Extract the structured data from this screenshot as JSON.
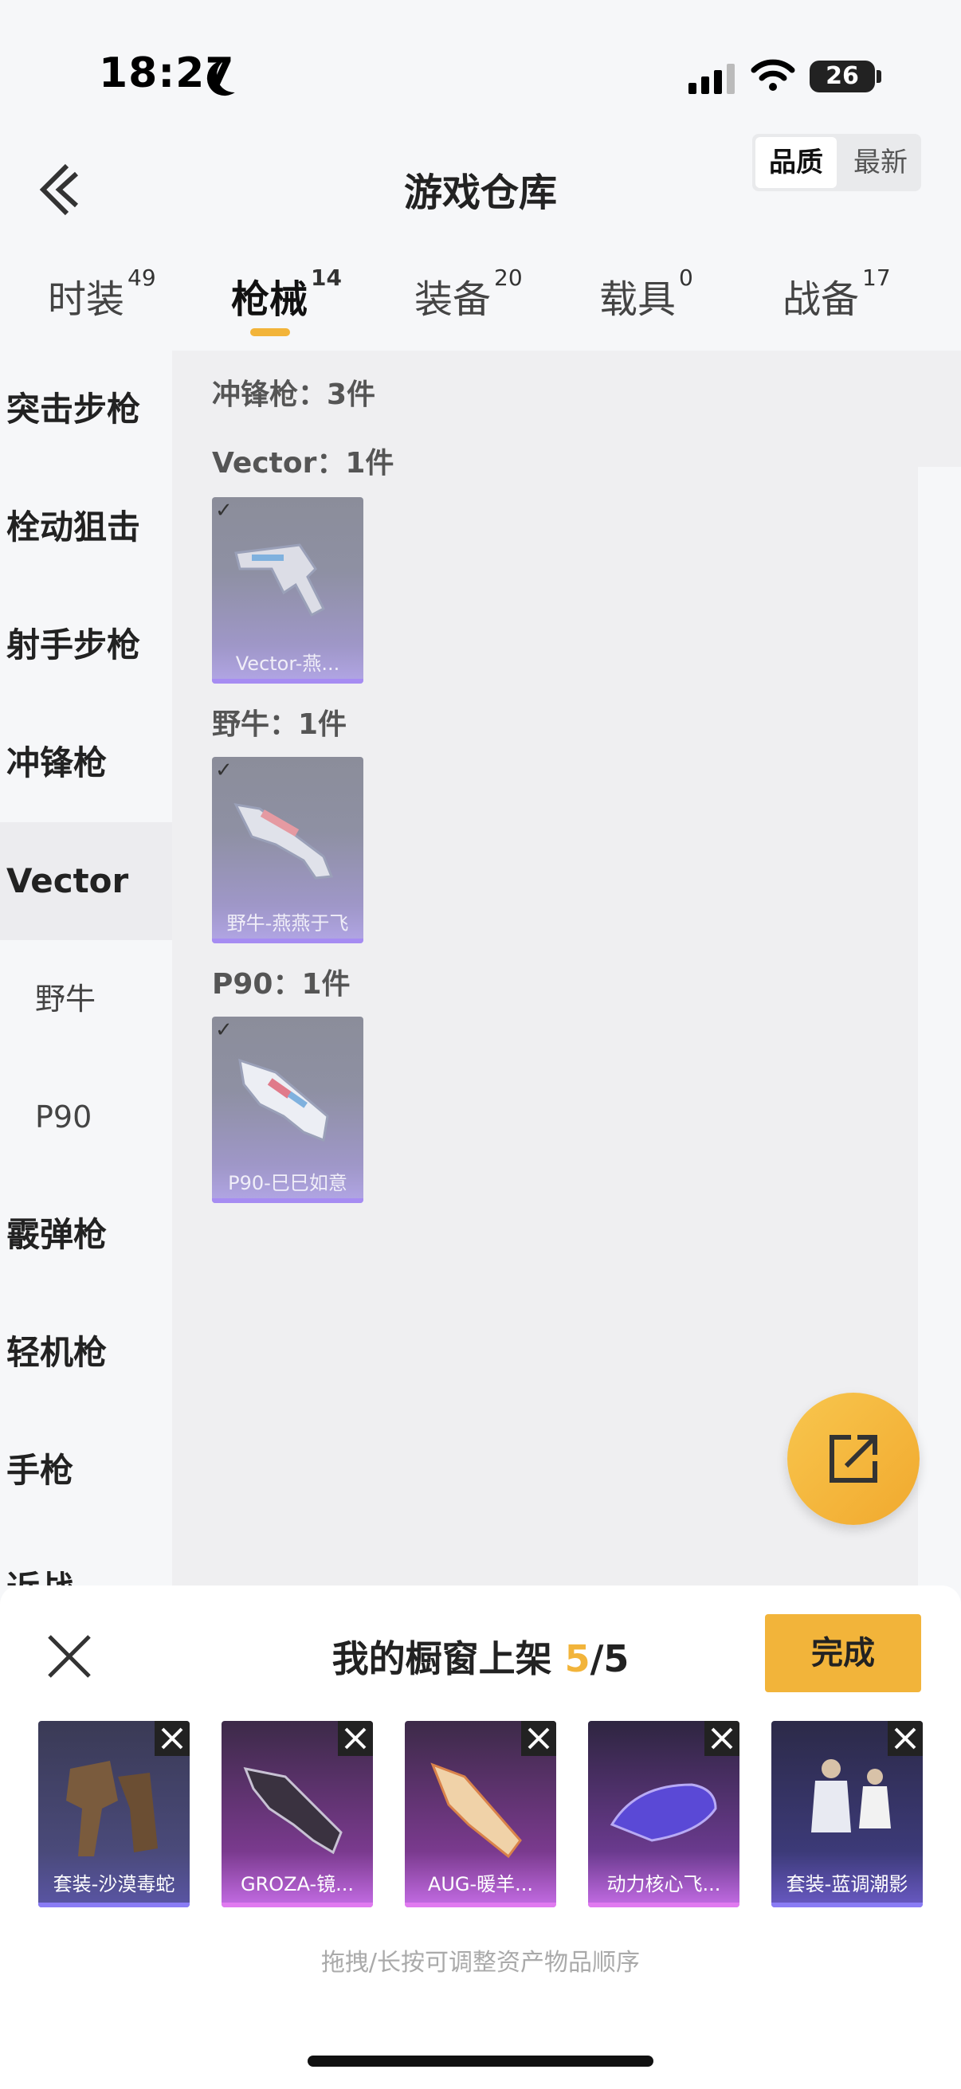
{
  "status": {
    "time": "18:27",
    "battery": "26"
  },
  "header": {
    "title": "游戏仓库",
    "sort_quality": "品质",
    "sort_newest": "最新"
  },
  "tabs": [
    {
      "label": "时装",
      "count": "49"
    },
    {
      "label": "枪械",
      "count": "14"
    },
    {
      "label": "装备",
      "count": "20"
    },
    {
      "label": "载具",
      "count": "0"
    },
    {
      "label": "战备",
      "count": "17"
    }
  ],
  "sidebar": {
    "items": [
      {
        "label": "突击步枪"
      },
      {
        "label": "栓动狙击"
      },
      {
        "label": "射手步枪"
      },
      {
        "label": "冲锋枪"
      },
      {
        "label": "Vector"
      },
      {
        "label": "野牛"
      },
      {
        "label": "P90"
      },
      {
        "label": "霰弹枪"
      },
      {
        "label": "轻机枪"
      },
      {
        "label": "手枪"
      },
      {
        "label": "近战"
      }
    ]
  },
  "content": {
    "category_summary": "冲锋枪：3件",
    "groups": [
      {
        "label": "Vector：1件",
        "item_name": "Vector-燕..."
      },
      {
        "label": "野牛：1件",
        "item_name": "野牛-燕燕于飞"
      },
      {
        "label": "P90：1件",
        "item_name": "P90-巳巳如意"
      }
    ]
  },
  "sheet": {
    "title_prefix": "我的橱窗上架 ",
    "count_current": "5",
    "count_sep": "/",
    "count_total": "5",
    "done_label": "完成",
    "items": [
      {
        "name": "套装-沙漠毒蛇"
      },
      {
        "name": "GROZA-镜..."
      },
      {
        "name": "AUG-暖羊..."
      },
      {
        "name": "动力核心飞..."
      },
      {
        "name": "套装-蓝调潮影"
      }
    ],
    "hint": "拖拽/长按可调整资产物品顺序"
  }
}
